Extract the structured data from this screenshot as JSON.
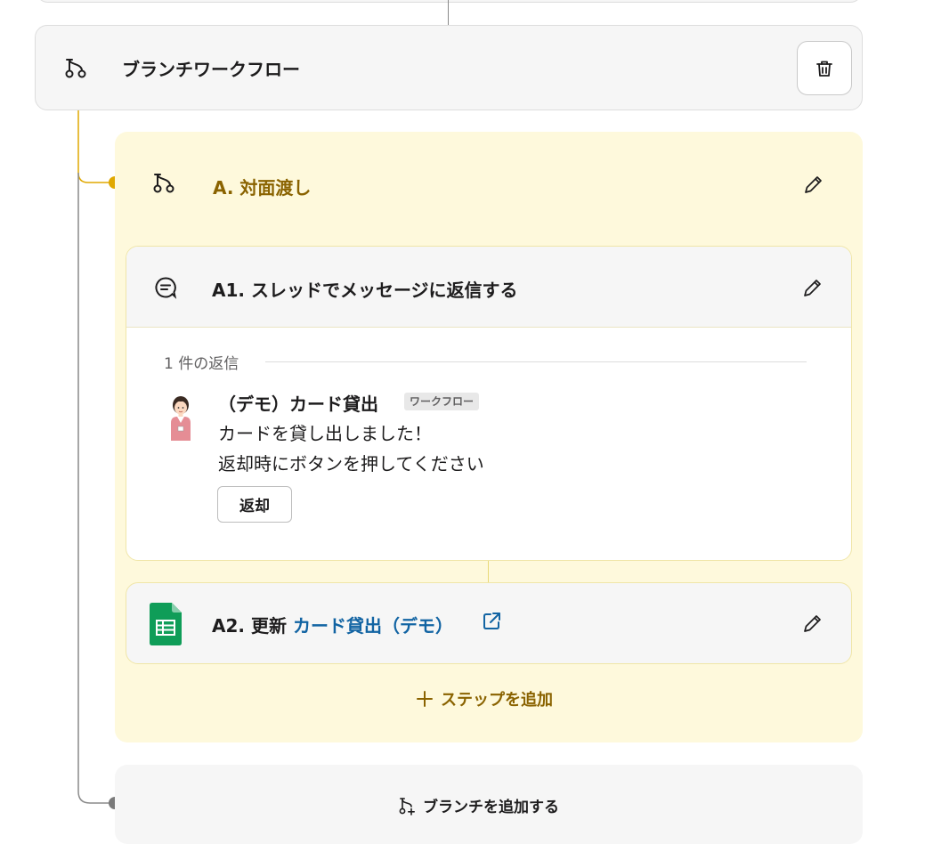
{
  "colors": {
    "branch_accent": "#e0a800",
    "branch_text": "#8a6300",
    "branch_panel_bg": "#fef9dc",
    "link": "#1264a3",
    "gray_connector": "#8a8a8a",
    "sheets_green": "#0f9d58"
  },
  "branch": {
    "icon": "branch-icon",
    "title": "ブランチワークフロー",
    "delete_icon": "trash-icon"
  },
  "branch_a": {
    "icon": "branch-icon",
    "title": "A. 対面渡し",
    "edit_icon": "pencil-icon",
    "steps": [
      {
        "icon": "message-reply-icon",
        "title": "A1. スレッドでメッセージに返信する",
        "edit_icon": "pencil-icon",
        "preview": {
          "reply_count": "1 件の返信",
          "avatar": "avatar-woman-icon",
          "sender": "（デモ）カード貸出",
          "tag": "ワークフロー",
          "line1": "カードを貸し出しました！",
          "line2": "返却時にボタンを押してください",
          "button": "返却"
        }
      },
      {
        "icon": "google-sheets-icon",
        "label": "A2. 更新",
        "link": "カード貸出（デモ）",
        "link_icon": "external-link-icon",
        "edit_icon": "pencil-icon"
      }
    ],
    "add_step": "ステップを追加"
  },
  "add_branch": {
    "icon": "add-branch-icon",
    "label": "ブランチを追加する"
  }
}
